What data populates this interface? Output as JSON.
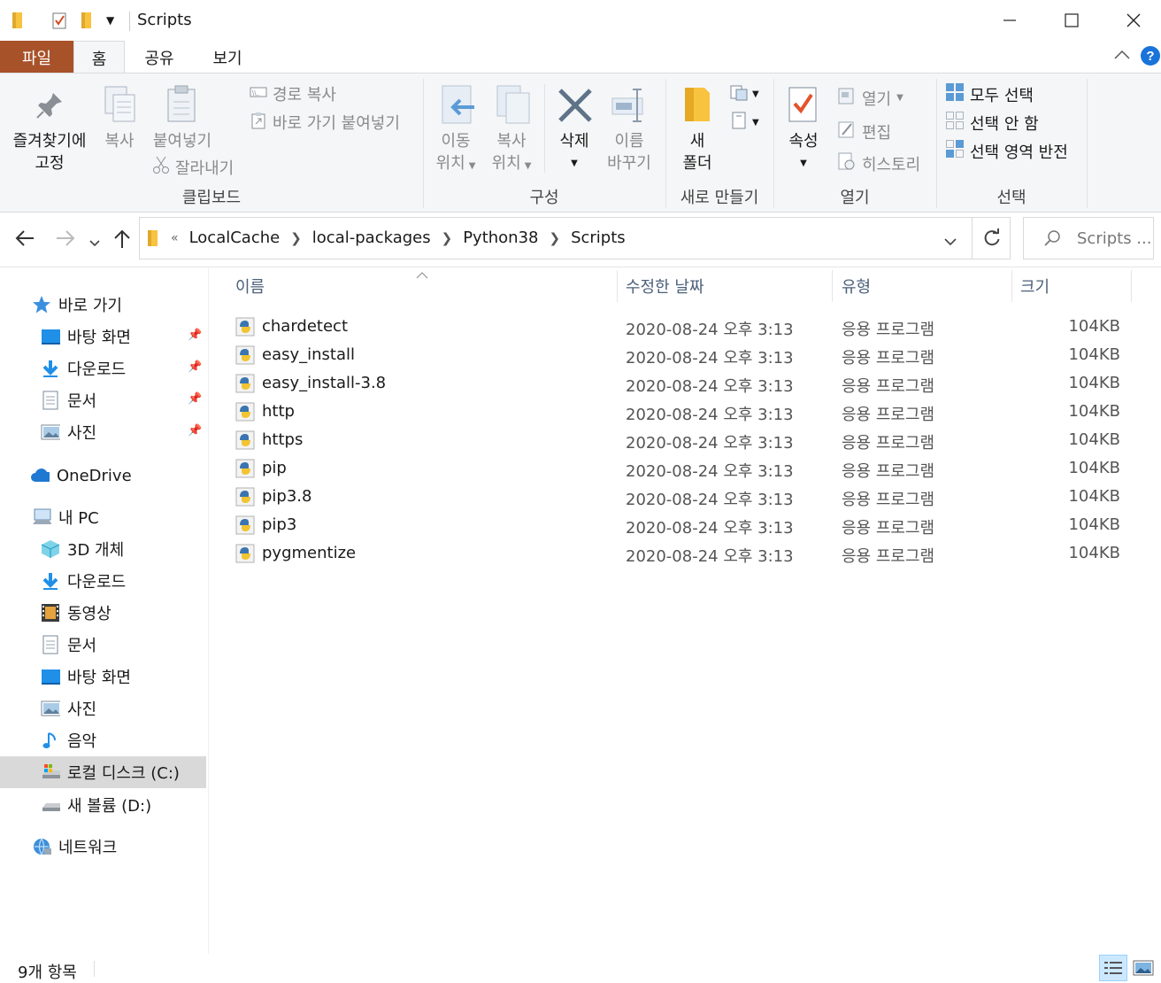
{
  "window": {
    "title": "Scripts"
  },
  "tabs": {
    "file": "파일",
    "home": "홈",
    "share": "공유",
    "view": "보기"
  },
  "ribbon": {
    "clipboard": {
      "pin_label_1": "즐겨찾기에",
      "pin_label_2": "고정",
      "copy": "복사",
      "paste": "붙여넣기",
      "copy_path": "경로 복사",
      "paste_shortcut": "바로 가기 붙여넣기",
      "cut": "잘라내기",
      "group": "클립보드"
    },
    "organize": {
      "move_1": "이동",
      "move_2": "위치",
      "copyto_1": "복사",
      "copyto_2": "위치",
      "delete": "삭제",
      "rename_1": "이름",
      "rename_2": "바꾸기",
      "group": "구성"
    },
    "new": {
      "folder_1": "새",
      "folder_2": "폴더",
      "group": "새로 만들기"
    },
    "open": {
      "properties": "속성",
      "open": "열기",
      "edit": "편집",
      "history": "히스토리",
      "group": "열기"
    },
    "select": {
      "all": "모두 선택",
      "none": "선택 안 함",
      "invert": "선택 영역 반전",
      "group": "선택"
    }
  },
  "address": {
    "breadcrumb": [
      "LocalCache",
      "local-packages",
      "Python38",
      "Scripts"
    ],
    "overflow": "«",
    "search_placeholder": "Scripts ..."
  },
  "nav": {
    "quick_access": "바로 가기",
    "qa_items": [
      "바탕 화면",
      "다운로드",
      "문서",
      "사진"
    ],
    "onedrive": "OneDrive",
    "this_pc": "내 PC",
    "pc_items": [
      "3D 개체",
      "다운로드",
      "동영상",
      "문서",
      "바탕 화면",
      "사진",
      "음악",
      "로컬 디스크 (C:)",
      "새 볼륨 (D:)"
    ],
    "network": "네트워크"
  },
  "columns": {
    "name": "이름",
    "date": "수정한 날짜",
    "type": "유형",
    "size": "크기"
  },
  "files": [
    {
      "name": "chardetect",
      "date": "2020-08-24 오후 3:13",
      "type": "응용 프로그램",
      "size": "104KB"
    },
    {
      "name": "easy_install",
      "date": "2020-08-24 오후 3:13",
      "type": "응용 프로그램",
      "size": "104KB"
    },
    {
      "name": "easy_install-3.8",
      "date": "2020-08-24 오후 3:13",
      "type": "응용 프로그램",
      "size": "104KB"
    },
    {
      "name": "http",
      "date": "2020-08-24 오후 3:13",
      "type": "응용 프로그램",
      "size": "104KB"
    },
    {
      "name": "https",
      "date": "2020-08-24 오후 3:13",
      "type": "응용 프로그램",
      "size": "104KB"
    },
    {
      "name": "pip",
      "date": "2020-08-24 오후 3:13",
      "type": "응용 프로그램",
      "size": "104KB"
    },
    {
      "name": "pip3.8",
      "date": "2020-08-24 오후 3:13",
      "type": "응용 프로그램",
      "size": "104KB"
    },
    {
      "name": "pip3",
      "date": "2020-08-24 오후 3:13",
      "type": "응용 프로그램",
      "size": "104KB"
    },
    {
      "name": "pygmentize",
      "date": "2020-08-24 오후 3:13",
      "type": "응용 프로그램",
      "size": "104KB"
    }
  ],
  "status": {
    "count": "9개 항목"
  },
  "colors": {
    "file_tab": "#a8522a",
    "accent": "#0078d7",
    "folder": "#f8c33f",
    "selected_nav": "#d9d9d9"
  }
}
